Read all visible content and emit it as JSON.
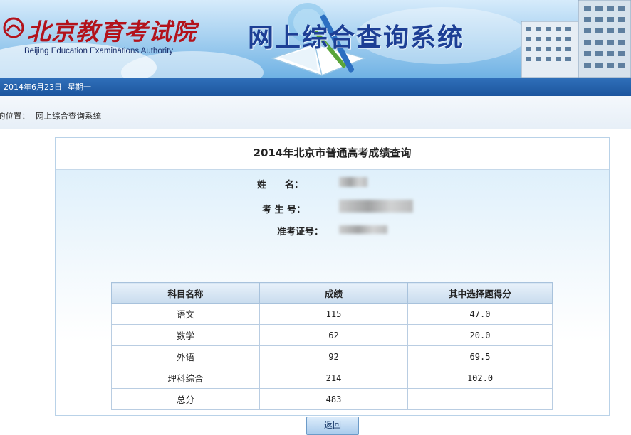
{
  "header": {
    "org_name_cn": "北京教育考试院",
    "org_name_en": "Beijing Education Examinations Authority",
    "system_title": "网上综合查询系统"
  },
  "datebar": {
    "date": "2014年6月23日",
    "weekday": "星期一"
  },
  "breadcrumb": {
    "prefix": "的位置：",
    "path": "网上综合查询系统"
  },
  "panel": {
    "title": "2014年北京市普通高考成绩查询",
    "fields": [
      {
        "label": "姓　　名：",
        "value_blurred": true
      },
      {
        "label": "考 生 号：",
        "value_blurred": true
      },
      {
        "label": "准考证号：",
        "value_blurred": true
      }
    ],
    "table": {
      "headers": [
        "科目名称",
        "成绩",
        "其中选择题得分"
      ],
      "rows": [
        {
          "subject": "语文",
          "score": "115",
          "choice": "47.0"
        },
        {
          "subject": "数学",
          "score": "62",
          "choice": "20.0"
        },
        {
          "subject": "外语",
          "score": "92",
          "choice": "69.5"
        },
        {
          "subject": "理科综合",
          "score": "214",
          "choice": "102.0"
        },
        {
          "subject": "总分",
          "score": "483",
          "choice": ""
        }
      ]
    },
    "return_button": "返回"
  },
  "colors": {
    "datebar": "#1c559e",
    "logo_red": "#b3121b",
    "title_blue": "#1d3f95",
    "panel_border": "#b9d2e8"
  }
}
